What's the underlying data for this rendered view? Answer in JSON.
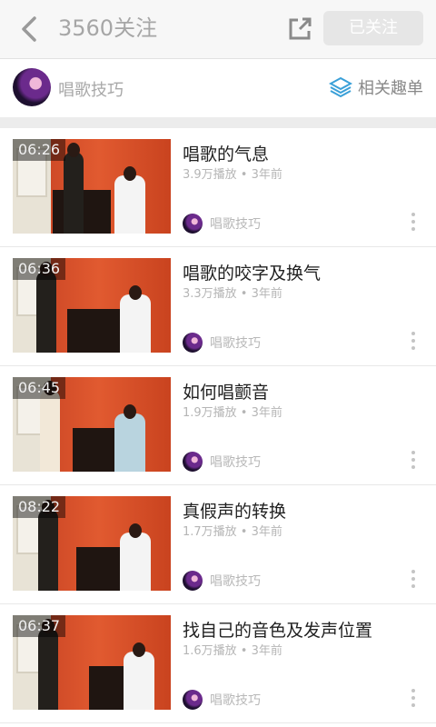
{
  "header": {
    "title": "3560关注",
    "follow_label": "已关注"
  },
  "channel": {
    "name": "唱歌技巧",
    "related_label": "相关趣单"
  },
  "videos": [
    {
      "duration": "06:26",
      "title": "唱歌的气息",
      "meta": "3.9万播放 • 3年前",
      "author": "唱歌技巧"
    },
    {
      "duration": "06:36",
      "title": "唱歌的咬字及换气",
      "meta": "3.3万播放 • 3年前",
      "author": "唱歌技巧"
    },
    {
      "duration": "06:45",
      "title": "如何唱颤音",
      "meta": "1.9万播放 • 3年前",
      "author": "唱歌技巧"
    },
    {
      "duration": "08:22",
      "title": "真假声的转换",
      "meta": "1.7万播放 • 3年前",
      "author": "唱歌技巧"
    },
    {
      "duration": "06:37",
      "title": "找自己的音色及发声位置",
      "meta": "1.6万播放 • 3年前",
      "author": "唱歌技巧"
    }
  ],
  "icons": {
    "back": "chevron-left-icon",
    "share": "share-icon",
    "related": "layers-icon",
    "more": "more-vertical-icon"
  },
  "colors": {
    "accent": "#3aa0d8",
    "title_gray": "#a6a6a6"
  }
}
